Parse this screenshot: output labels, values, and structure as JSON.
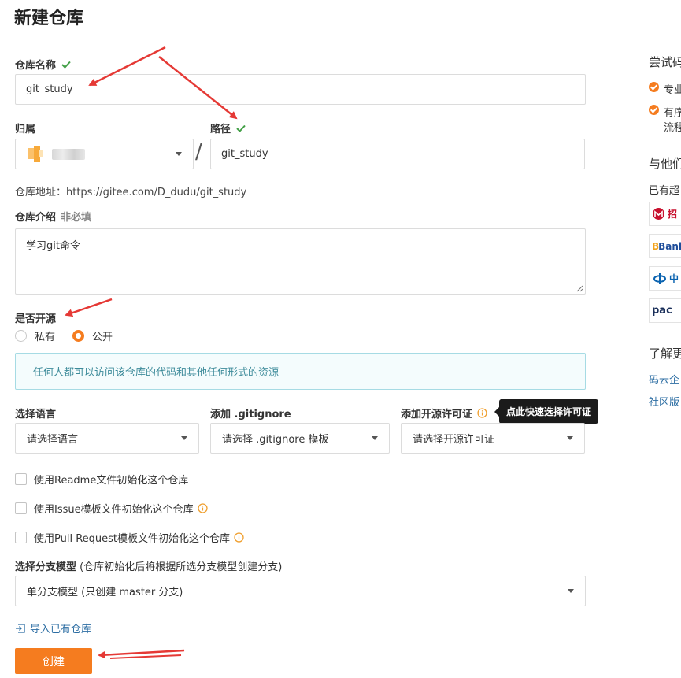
{
  "page": {
    "title": "新建仓库"
  },
  "repo_name": {
    "label": "仓库名称",
    "value": "git_study"
  },
  "owner": {
    "label": "归属"
  },
  "path": {
    "label": "路径",
    "value": "git_study",
    "separator": "/"
  },
  "repo_url": {
    "text": "仓库地址：https://gitee.com/D_dudu/git_study"
  },
  "description": {
    "label": "仓库介绍",
    "optional": "非必填",
    "value": "学习git命令"
  },
  "visibility": {
    "label": "是否开源",
    "options": [
      {
        "label": "私有",
        "checked": false
      },
      {
        "label": "公开",
        "checked": true
      }
    ],
    "hint": "任何人都可以访问该仓库的代码和其他任何形式的资源"
  },
  "language": {
    "label": "选择语言",
    "placeholder": "请选择语言"
  },
  "gitignore": {
    "label": "添加 .gitignore",
    "placeholder": "请选择 .gitignore 模板"
  },
  "license": {
    "label": "添加开源许可证",
    "placeholder": "请选择开源许可证",
    "tooltip": "点此快速选择许可证"
  },
  "init_options": [
    {
      "label": "使用Readme文件初始化这个仓库",
      "info": false
    },
    {
      "label": "使用Issue模板文件初始化这个仓库",
      "info": true
    },
    {
      "label": "使用Pull Request模板文件初始化这个仓库",
      "info": true
    }
  ],
  "branch_model": {
    "label": "选择分支模型",
    "note": " (仓库初始化后将根据所选分支模型创建分支)",
    "value": "单分支模型 (只创建 master 分支)"
  },
  "import_link": {
    "label": "导入已有仓库"
  },
  "create_button": {
    "label": "创建"
  },
  "sidebar": {
    "heading1": "尝试码",
    "bullet1": "专业",
    "bullet2": "有序",
    "bullet2_cont": "流程",
    "heading2": "与他们",
    "used_by": "已有超",
    "logos": [
      "招",
      "Bank",
      "中",
      "pac"
    ],
    "heading3": "了解更",
    "link1": "码云企",
    "link2": "社区版"
  },
  "colors": {
    "accent": "#f57c1f",
    "success": "#43a047",
    "link": "#2d6ea3",
    "annotation": "#e53935"
  }
}
